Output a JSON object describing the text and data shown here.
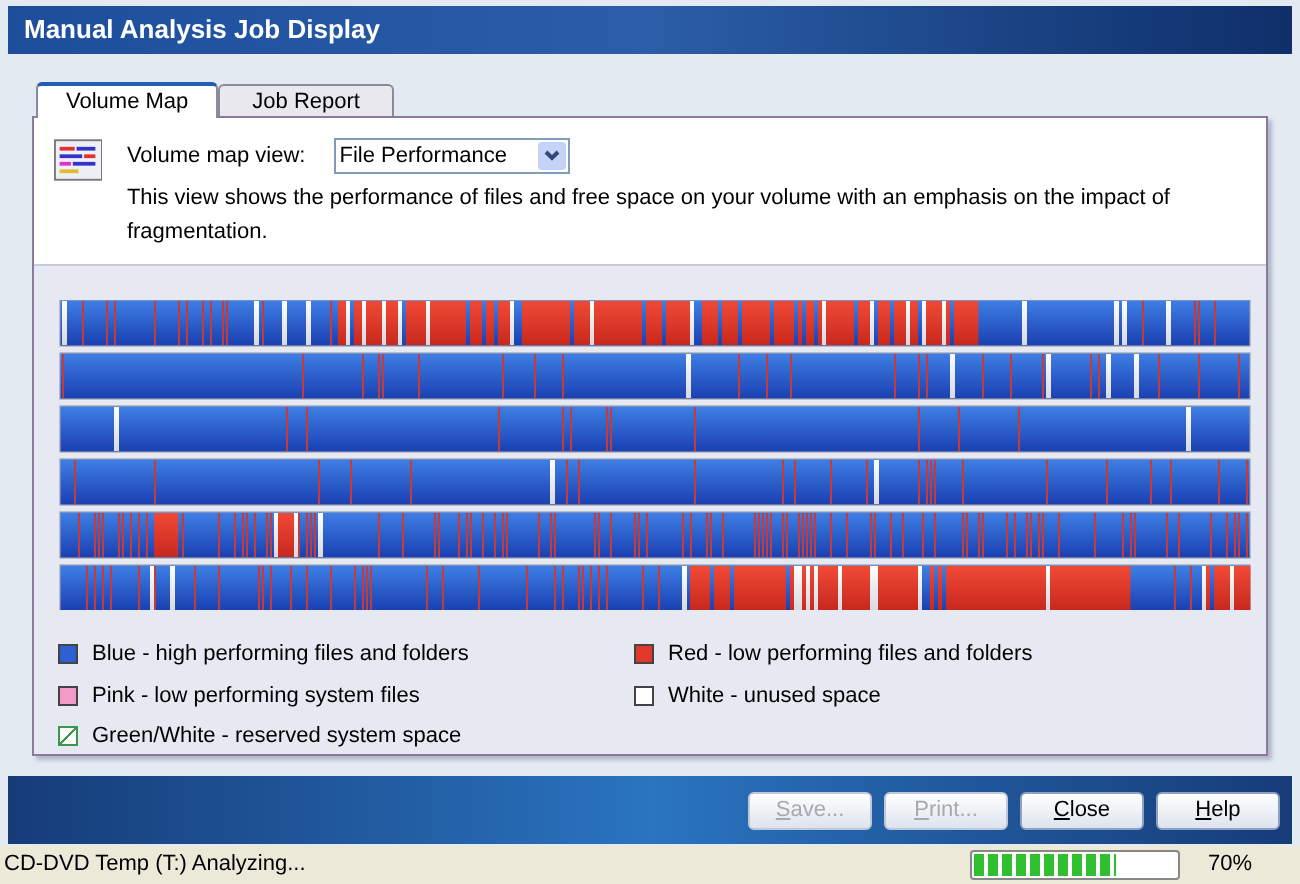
{
  "window": {
    "title": "Manual Analysis Job Display"
  },
  "tabs": [
    {
      "label": "Volume Map",
      "selected": true
    },
    {
      "label": "Job Report",
      "selected": false
    }
  ],
  "view": {
    "label": "Volume map view:",
    "value": "File Performance",
    "description": "This view shows the performance of files and free space on your volume with an emphasis on the impact of fragmentation."
  },
  "legend": [
    {
      "label": "Blue - high performing files and folders",
      "color": "#2f5fd0"
    },
    {
      "label": "Red - low performing files and folders",
      "color": "#e0382c"
    },
    {
      "label": "Pink - low performing system files",
      "color": "#f49ac8"
    },
    {
      "label": "White - unused space",
      "color": "#ffffff"
    },
    {
      "label": "Green/White - reserved system space",
      "color": "#3a9a4a"
    }
  ],
  "buttons": [
    {
      "label": "Save...",
      "disabled": true
    },
    {
      "label": "Print...",
      "disabled": true
    },
    {
      "label": "Close",
      "disabled": false
    },
    {
      "label": "Help",
      "disabled": false
    }
  ],
  "status_bar": {
    "text": "CD-DVD Temp (T:) Analyzing...",
    "progress": {
      "level": 0.7
    },
    "reading": "70%"
  }
}
